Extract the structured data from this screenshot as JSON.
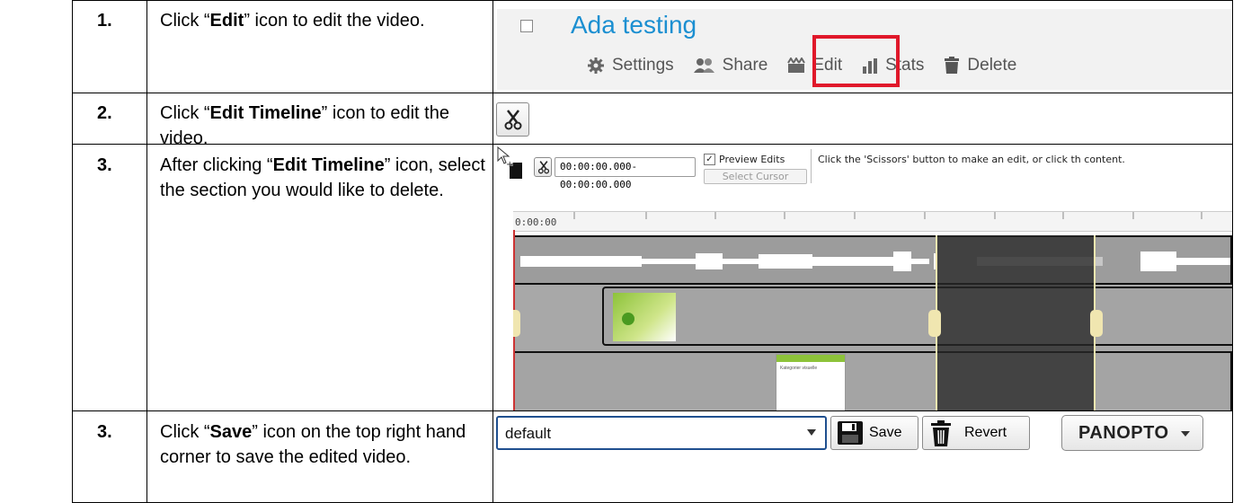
{
  "rows": [
    {
      "num": "1.",
      "pre": "Click “",
      "bold": "Edit",
      "post": "” icon to edit the video."
    },
    {
      "num": "2.",
      "pre": "Click “",
      "bold": "Edit Timeline",
      "post": "” icon to edit the video."
    },
    {
      "num": "3.",
      "pre": "After clicking “",
      "bold": "Edit Timeline",
      "post": "” icon, select the section you would like to delete."
    },
    {
      "num": "3.",
      "pre": "Click “",
      "bold": "Save",
      "post": "” icon on the top right hand corner to save the edited video."
    }
  ],
  "session": {
    "title": "Ada testing",
    "actions": [
      "Settings",
      "Share",
      "Edit",
      "Stats",
      "Delete"
    ],
    "highlight_color": "#e0182a",
    "link_color": "#1b8fd1"
  },
  "editor": {
    "timecode": "00:00:00.000-00:00:00.000",
    "preview_label": "Preview Edits",
    "select_cursor": "Select Cursor",
    "hint": "Click the 'Scissors' button to make an edit, or click th content.",
    "time_label": "0:00:00",
    "slide_caption": "Kategorier visuelle"
  },
  "footer": {
    "dropdown_value": "default",
    "save_label": "Save",
    "revert_label": "Revert",
    "brand": "PANOPTO"
  },
  "icons": [
    "checkbox-icon",
    "gear-icon",
    "people-icon",
    "clapper-icon",
    "bar-chart-icon",
    "trash-icon",
    "scissors-icon",
    "add-media-icon",
    "disk-icon",
    "chevron-down-icon"
  ]
}
